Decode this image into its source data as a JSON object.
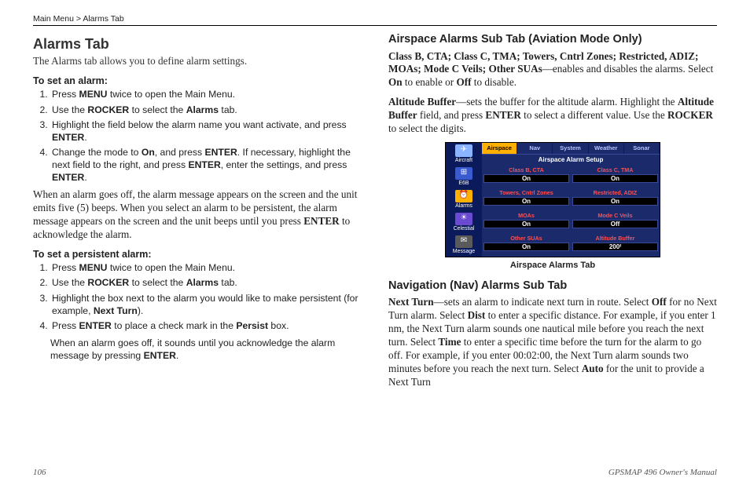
{
  "breadcrumb": {
    "root": "Main Menu >",
    "tab": " Alarms Tab"
  },
  "left": {
    "h1": "Alarms Tab",
    "intro": "The Alarms tab allows you to define alarm settings.",
    "sub1": "To set an alarm:",
    "steps1": {
      "s1a": "Press ",
      "s1b": "MENU",
      "s1c": " twice to open the Main Menu.",
      "s2a": "Use the ",
      "s2b": "ROCKER",
      "s2c": " to select the ",
      "s2d": "Alarms",
      "s2e": " tab.",
      "s3a": "Highlight the field below the alarm name you want activate, and press ",
      "s3b": "ENTER",
      "s3c": ".",
      "s4a": "Change the mode to ",
      "s4b": "On",
      "s4c": ", and press ",
      "s4d": "ENTER",
      "s4e": ". If necessary, highlight the next field to the right, and press ",
      "s4f": "ENTER",
      "s4g": ", enter the settings, and press ",
      "s4h": "ENTER",
      "s4i": "."
    },
    "para1a": "When an alarm goes off, the alarm message appears on the screen and the unit emits five (5) beeps. When you select an alarm to be persistent, the alarm message appears on the screen and the unit beeps until you press ",
    "para1b": "ENTER",
    "para1c": " to acknowledge the alarm.",
    "sub2": "To set a persistent alarm:",
    "steps2": {
      "s1a": "Press ",
      "s1b": "MENU",
      "s1c": " twice to open the Main Menu.",
      "s2a": "Use the ",
      "s2b": "ROCKER",
      "s2c": " to select the ",
      "s2d": "Alarms",
      "s2e": " tab.",
      "s3a": "Highlight the box next to the alarm you would like to make persistent (for example, ",
      "s3b": "Next Turn",
      "s3c": ").",
      "s4a": "Press ",
      "s4b": "ENTER",
      "s4c": " to place a check mark in the ",
      "s4d": "Persist",
      "s4e": " box.",
      "note_a": "When an alarm goes off, it sounds until you acknowledge the alarm message by pressing ",
      "note_b": "ENTER",
      "note_c": "."
    }
  },
  "right": {
    "h2a": "Airspace Alarms Sub Tab (Aviation Mode Only)",
    "p1a": "Class B, CTA; Class C, TMA; Towers, Cntrl Zones; Restricted, ADIZ; MOAs; Mode C Veils; Other SUAs",
    "p1b": "—enables and disables the alarms. Select ",
    "p1c": "On",
    "p1d": " to enable or ",
    "p1e": "Off",
    "p1f": " to disable.",
    "p2a": "Altitude Buffer",
    "p2b": "—sets the buffer for the altitude alarm. Highlight the ",
    "p2c": "Altitude Buffer",
    "p2d": " field, and press ",
    "p2e": "ENTER",
    "p2f": " to select a different value. Use the ",
    "p2g": "ROCKER",
    "p2h": " to select the digits.",
    "caption": "Airspace Alarms Tab",
    "h2b": "Navigation (Nav) Alarms Sub Tab",
    "p3a": "Next Turn",
    "p3b": "—sets an alarm to indicate next turn in route. Select ",
    "p3c": "Off",
    "p3d": " for no Next Turn alarm. Select ",
    "p3e": "Dist",
    "p3f": " to enter a specific distance. For example, if you enter 1 nm, the Next Turn alarm sounds one nautical mile before you reach the next turn. Select ",
    "p3g": "Time",
    "p3h": " to enter a specific time before the turn for the alarm to go off. For example, if you enter 00:02:00, the Next Turn alarm sounds two minutes before you reach the next turn. Select ",
    "p3i": "Auto",
    "p3j": " for the unit to provide a Next Turn"
  },
  "device": {
    "tabs": [
      "Airspace",
      "Nav",
      "System",
      "Weather",
      "Sonar"
    ],
    "title": "Airspace Alarm Setup",
    "side": [
      {
        "label": "Aircraft",
        "bg": "#8ab4ff"
      },
      {
        "label": "E6B",
        "bg": "#3a5ad0"
      },
      {
        "label": "Alarms",
        "bg": "#ffb000"
      },
      {
        "label": "Celestial",
        "bg": "#6a4ad0"
      },
      {
        "label": "Message",
        "bg": "#5a5a5a"
      }
    ],
    "cells": [
      {
        "label": "Class B, CTA",
        "val": "On"
      },
      {
        "label": "Class C, TMA",
        "val": "On"
      },
      {
        "label": "Towers, Cntrl Zones",
        "val": "On"
      },
      {
        "label": "Restricted, ADIZ",
        "val": "On"
      },
      {
        "label": "MOAs",
        "val": "On"
      },
      {
        "label": "Mode C Veils",
        "val": "Off"
      },
      {
        "label": "Other SUAs",
        "val": "On"
      },
      {
        "label": "Altitude Buffer",
        "val": "200ᶠ"
      }
    ]
  },
  "footer": {
    "page": "106",
    "manual": "GPSMAP 496 Owner's Manual"
  }
}
